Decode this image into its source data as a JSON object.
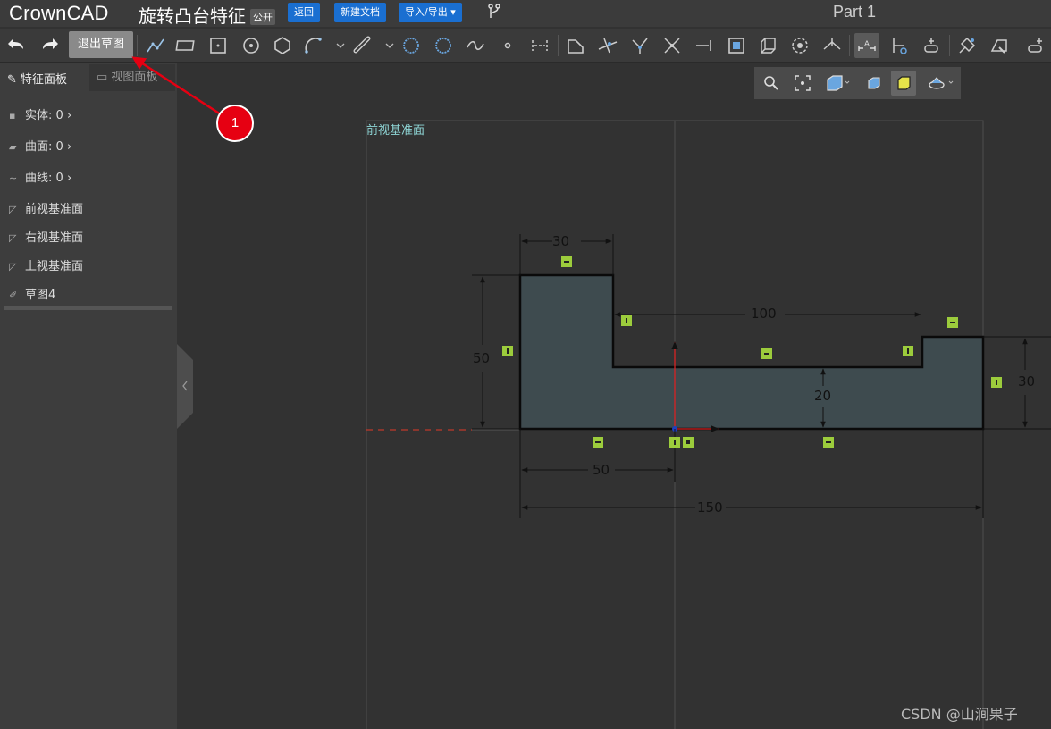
{
  "app": {
    "logo": "CrownCAD",
    "doc_title": "旋转凸台特征",
    "visibility_badge": "公开",
    "part_name": "Part 1"
  },
  "header_buttons": {
    "back": "返回",
    "new_doc": "新建文档",
    "import_export": "导入/导出 ▾"
  },
  "toolbar": {
    "exit_sketch": "退出草图"
  },
  "sidebar": {
    "tab_feature": "特征面板",
    "tab_view": "视图面板",
    "items": [
      {
        "label": "实体: 0",
        "icon": "solid-icon",
        "arrow": "›"
      },
      {
        "label": "曲面: 0",
        "icon": "surface-icon",
        "arrow": "›"
      },
      {
        "label": "曲线: 0",
        "icon": "curve-icon",
        "arrow": "›"
      },
      {
        "label": "前视基准面",
        "icon": "plane-icon"
      },
      {
        "label": "右视基准面",
        "icon": "plane-icon"
      },
      {
        "label": "上视基准面",
        "icon": "plane-icon"
      },
      {
        "label": "草图4",
        "icon": "sketch-icon"
      }
    ]
  },
  "canvas": {
    "plane_label": "前视基准面",
    "dimensions": {
      "top_width": "30",
      "left_height": "50",
      "step_length": "100",
      "inner_height": "20",
      "right_height": "30",
      "offset": "50",
      "total_width": "150"
    }
  },
  "callout": "1",
  "watermark": "CSDN @山涧果子",
  "colors": {
    "accent_button": "#1a6fd1",
    "callout": "#e60012",
    "constraint_marker": "#9ccc3c",
    "sketch_fill": "#3e4b4f"
  }
}
